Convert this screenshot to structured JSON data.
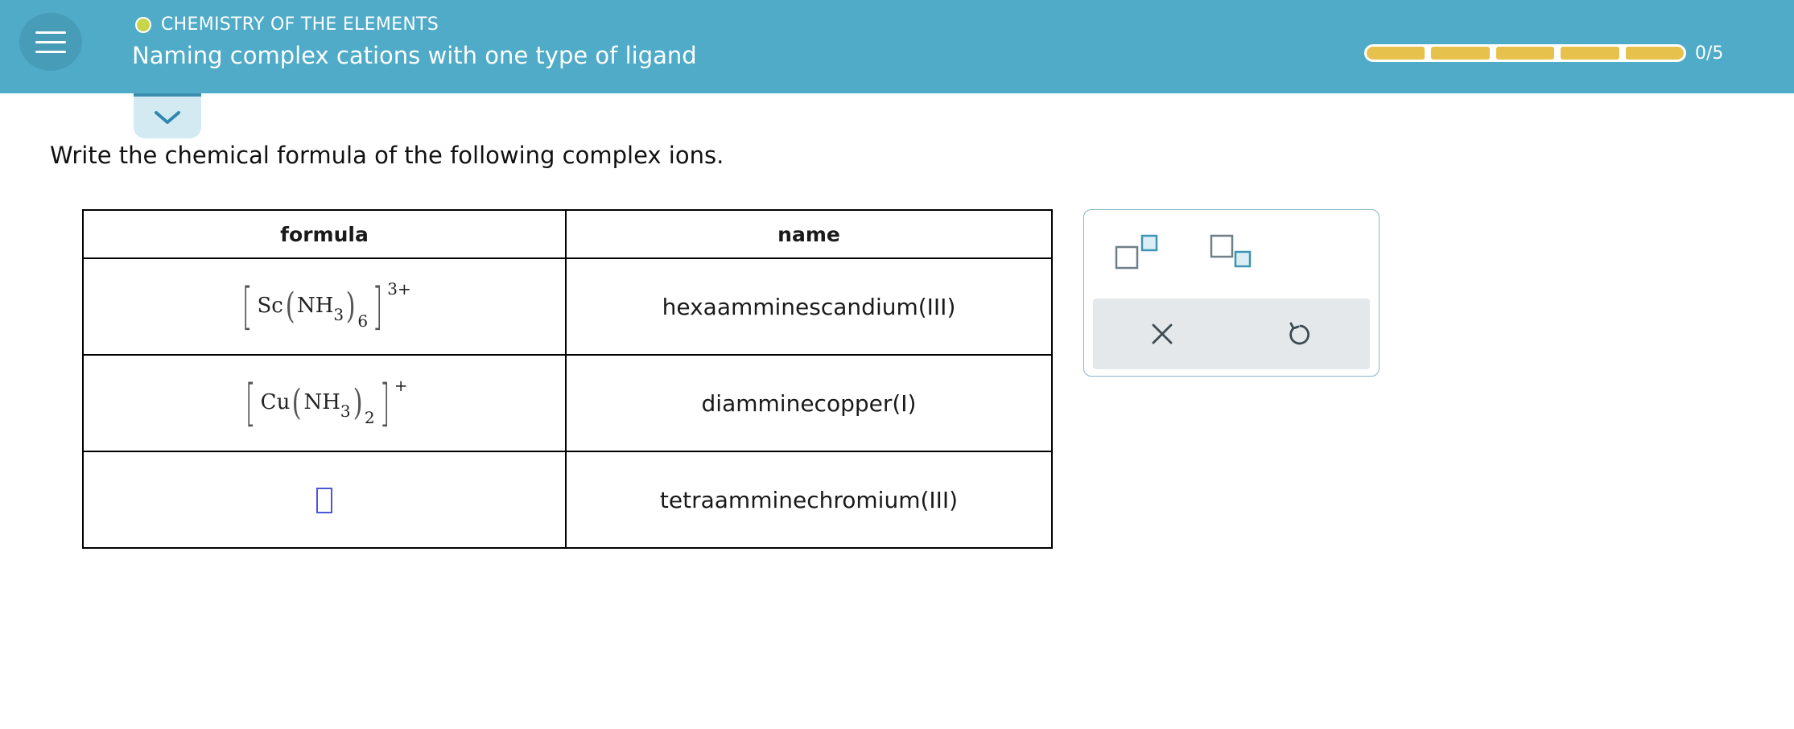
{
  "header": {
    "topic": "CHEMISTRY OF THE ELEMENTS",
    "title": "Naming complex cations with one type of ligand",
    "progress": {
      "completed": 0,
      "total": 5,
      "label": "0/5"
    },
    "accent_color": "#4fabc8",
    "progress_color": "#e6c24d"
  },
  "instruction": "Write the chemical formula of the following complex ions.",
  "table": {
    "headers": {
      "formula": "formula",
      "name": "name"
    },
    "rows": [
      {
        "formula": {
          "metal": "Sc",
          "ligand": "NH",
          "ligand_sub": "3",
          "count": "6",
          "charge": "3+"
        },
        "name": "hexaamminescandium(III)"
      },
      {
        "formula": {
          "metal": "Cu",
          "ligand": "NH",
          "ligand_sub": "3",
          "count": "2",
          "charge": "+"
        },
        "name": "diamminecopper(I)"
      },
      {
        "formula": null,
        "name": "tetraamminechromium(III)"
      }
    ]
  },
  "toolbox": {
    "tools": [
      "superscript-icon",
      "subscript-icon"
    ],
    "actions": [
      "clear-icon",
      "undo-icon"
    ]
  }
}
